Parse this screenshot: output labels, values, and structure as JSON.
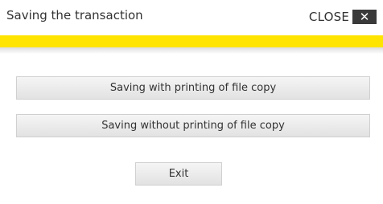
{
  "dialog": {
    "title": "Saving the transaction",
    "close_label": "CLOSE",
    "close_icon": "✕",
    "accent_color": "#ffe400"
  },
  "buttons": {
    "save_with_print": "Saving with printing of file copy",
    "save_without_print": "Saving without printing of file copy",
    "exit": "Exit"
  }
}
